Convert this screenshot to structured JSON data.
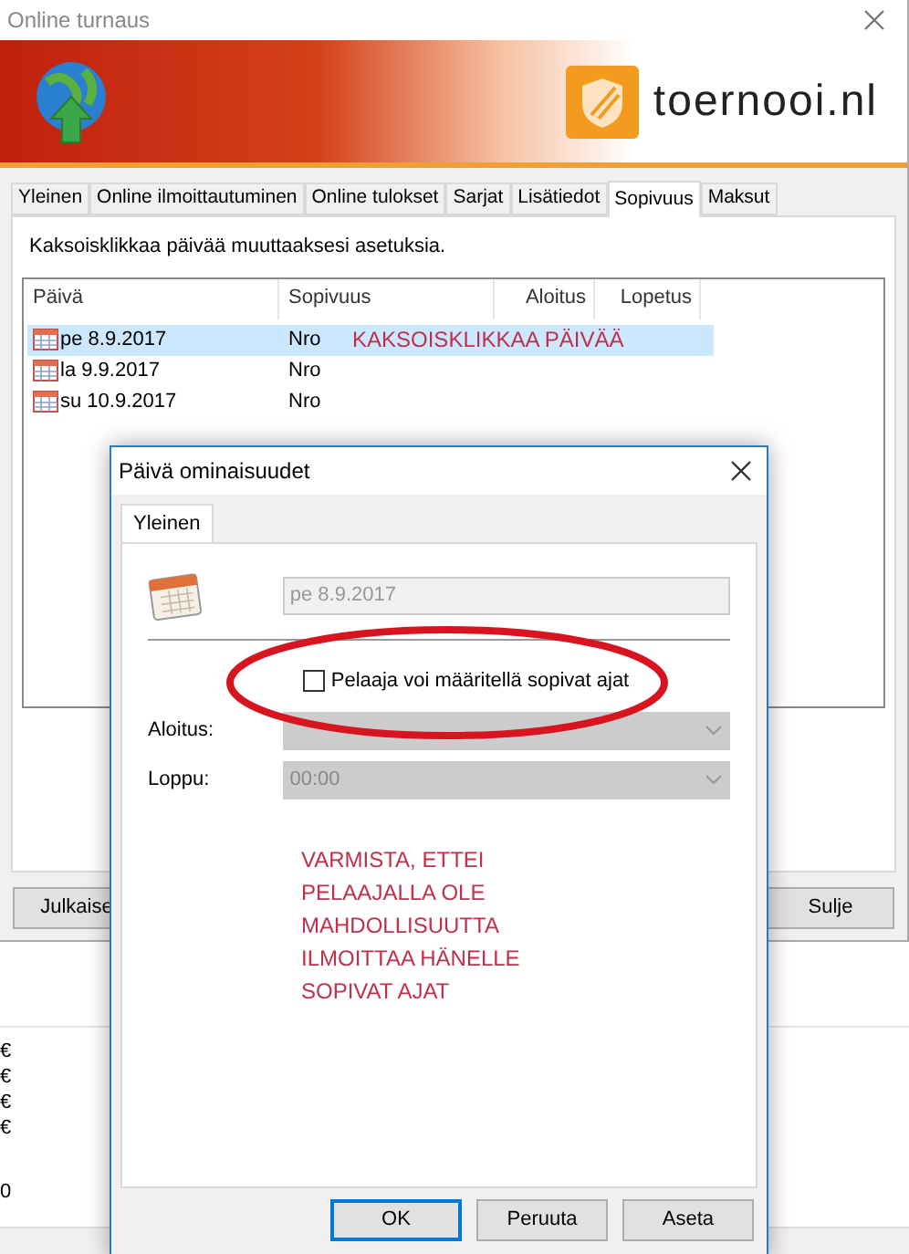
{
  "window": {
    "title": "Online turnaus"
  },
  "banner": {
    "logo_text": "toernooi.nl"
  },
  "tabs": [
    {
      "label": "Yleinen",
      "selected": false
    },
    {
      "label": "Online ilmoittautuminen",
      "selected": false
    },
    {
      "label": "Online tulokset",
      "selected": false
    },
    {
      "label": "Sarjat",
      "selected": false
    },
    {
      "label": "Lisätiedot",
      "selected": false
    },
    {
      "label": "Sopivuus",
      "selected": true
    },
    {
      "label": "Maksut",
      "selected": false
    }
  ],
  "instruction": "Kaksoisklikkaa päivää muuttaaksesi asetuksia.",
  "table": {
    "columns": [
      "Päivä",
      "Sopivuus",
      "Aloitus",
      "Lopetus"
    ],
    "rows": [
      {
        "date": "pe 8.9.2017",
        "availability": "Nro",
        "selected": true
      },
      {
        "date": "la 9.9.2017",
        "availability": "Nro",
        "selected": false
      },
      {
        "date": "su 10.9.2017",
        "availability": "Nro",
        "selected": false
      }
    ],
    "annotation": "KAKSOISKLIKKAA PÄIVÄÄ"
  },
  "buttons": [
    "Julkaise",
    "Sulje"
  ],
  "background": {
    "euro_marks": [
      "€",
      "€",
      "€",
      "€"
    ],
    "number": "0"
  },
  "dialog": {
    "title": "Päivä ominaisuudet",
    "tabs": [
      {
        "label": "Yleinen",
        "selected": true
      }
    ],
    "date_field": {
      "value": "pe 8.9.2017",
      "disabled": true
    },
    "checkbox": {
      "label": "Pelaaja voi määritellä sopivat ajat",
      "checked": false
    },
    "fields": [
      {
        "label": "Aloitus:",
        "disabled": true
      },
      {
        "label": "Loppu:",
        "value": "00:00",
        "disabled": true
      }
    ],
    "note": [
      "VARMISTA, ETTEI",
      "PELAAJALLA OLE",
      "MAHDOLLISUUTTA",
      "ILMOITTAA HÄNELLE",
      "SOPIVAT AJAT"
    ],
    "buttons": [
      {
        "label": "OK",
        "default": true
      },
      {
        "label": "Peruuta",
        "default": false
      },
      {
        "label": "Aseta",
        "default": false
      }
    ]
  }
}
